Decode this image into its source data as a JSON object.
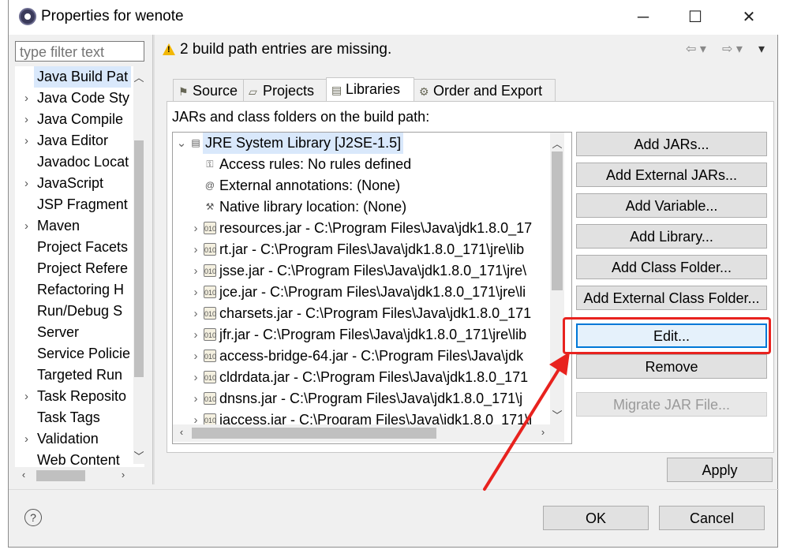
{
  "window": {
    "title": "Properties for wenote",
    "minimize_glyph": "─",
    "maximize_glyph": "☐",
    "close_glyph": "✕"
  },
  "nav": {
    "filter_placeholder": "type filter text",
    "items": [
      {
        "label": "Java Build Pat",
        "expandable": false,
        "selected": true
      },
      {
        "label": "Java Code Sty",
        "expandable": true
      },
      {
        "label": "Java Compile",
        "expandable": true
      },
      {
        "label": "Java Editor",
        "expandable": true
      },
      {
        "label": "Javadoc Locat",
        "expandable": false
      },
      {
        "label": "JavaScript",
        "expandable": true
      },
      {
        "label": "JSP Fragment",
        "expandable": false
      },
      {
        "label": "Maven",
        "expandable": true
      },
      {
        "label": "Project Facets",
        "expandable": false
      },
      {
        "label": "Project Refere",
        "expandable": false
      },
      {
        "label": "Refactoring H",
        "expandable": false
      },
      {
        "label": "Run/Debug S",
        "expandable": false
      },
      {
        "label": "Server",
        "expandable": false
      },
      {
        "label": "Service Policie",
        "expandable": false
      },
      {
        "label": "Targeted Run",
        "expandable": false
      },
      {
        "label": "Task Reposito",
        "expandable": true
      },
      {
        "label": "Task Tags",
        "expandable": false
      },
      {
        "label": "Validation",
        "expandable": true
      },
      {
        "label": "Web Content",
        "expandable": false
      }
    ]
  },
  "header": {
    "warning": "2 build path entries are missing."
  },
  "tabs": [
    {
      "label": "Source",
      "icon": "source-icon",
      "glyph": "⚑"
    },
    {
      "label": "Projects",
      "icon": "projects-icon",
      "glyph": "▱"
    },
    {
      "label": "Libraries",
      "icon": "libraries-icon",
      "glyph": "▤"
    },
    {
      "label": "Order and Export",
      "icon": "order-icon",
      "glyph": "⚙"
    }
  ],
  "active_tab": "Libraries",
  "libraries": {
    "heading": "JARs and class folders on the build path:",
    "entries": [
      {
        "label": "JRE System Library [J2SE-1.5]",
        "level": 0,
        "chevron": "⌄",
        "icon": "library-icon",
        "glyph": "▤",
        "selected": true
      },
      {
        "label": "Access rules: No rules defined",
        "level": 1,
        "chevron": "",
        "icon": "access-rules-icon",
        "glyph": "⚿"
      },
      {
        "label": "External annotations: (None)",
        "level": 1,
        "chevron": "",
        "icon": "annotations-icon",
        "glyph": "@"
      },
      {
        "label": "Native library location: (None)",
        "level": 1,
        "chevron": "",
        "icon": "native-library-icon",
        "glyph": "⚒"
      },
      {
        "label": "resources.jar - C:\\Program Files\\Java\\jdk1.8.0_17",
        "level": 1,
        "chevron": "›",
        "icon": "jar-icon",
        "glyph": "010"
      },
      {
        "label": "rt.jar - C:\\Program Files\\Java\\jdk1.8.0_171\\jre\\lib",
        "level": 1,
        "chevron": "›",
        "icon": "jar-icon",
        "glyph": "010"
      },
      {
        "label": "jsse.jar - C:\\Program Files\\Java\\jdk1.8.0_171\\jre\\",
        "level": 1,
        "chevron": "›",
        "icon": "jar-icon",
        "glyph": "010"
      },
      {
        "label": "jce.jar - C:\\Program Files\\Java\\jdk1.8.0_171\\jre\\li",
        "level": 1,
        "chevron": "›",
        "icon": "jar-icon",
        "glyph": "010"
      },
      {
        "label": "charsets.jar - C:\\Program Files\\Java\\jdk1.8.0_171",
        "level": 1,
        "chevron": "›",
        "icon": "jar-icon",
        "glyph": "010"
      },
      {
        "label": "jfr.jar - C:\\Program Files\\Java\\jdk1.8.0_171\\jre\\lib",
        "level": 1,
        "chevron": "›",
        "icon": "jar-icon",
        "glyph": "010"
      },
      {
        "label": "access-bridge-64.jar - C:\\Program Files\\Java\\jdk",
        "level": 1,
        "chevron": "›",
        "icon": "jar-icon",
        "glyph": "010"
      },
      {
        "label": "cldrdata.jar - C:\\Program Files\\Java\\jdk1.8.0_171",
        "level": 1,
        "chevron": "›",
        "icon": "jar-icon",
        "glyph": "010"
      },
      {
        "label": "dnsns.jar - C:\\Program Files\\Java\\jdk1.8.0_171\\j",
        "level": 1,
        "chevron": "›",
        "icon": "jar-icon",
        "glyph": "010"
      },
      {
        "label": "jaccess.jar - C:\\Program Files\\Java\\jdk1.8.0_171\\j",
        "level": 1,
        "chevron": "›",
        "icon": "jar-icon",
        "glyph": "010"
      }
    ]
  },
  "buttons": {
    "add_jars": "Add JARs...",
    "add_external_jars": "Add External JARs...",
    "add_variable": "Add Variable...",
    "add_library": "Add Library...",
    "add_class_folder": "Add Class Folder...",
    "add_external_class_folder": "Add External Class Folder...",
    "edit": "Edit...",
    "remove": "Remove",
    "migrate_jar": "Migrate JAR File...",
    "apply": "Apply",
    "ok": "OK",
    "cancel": "Cancel"
  },
  "footer": {
    "help_glyph": "?"
  },
  "colors": {
    "selection": "#d9e8fb",
    "annotation_red": "#e8221e",
    "focus_blue": "#0078d7",
    "dialog_bg": "#f0f0f0"
  }
}
